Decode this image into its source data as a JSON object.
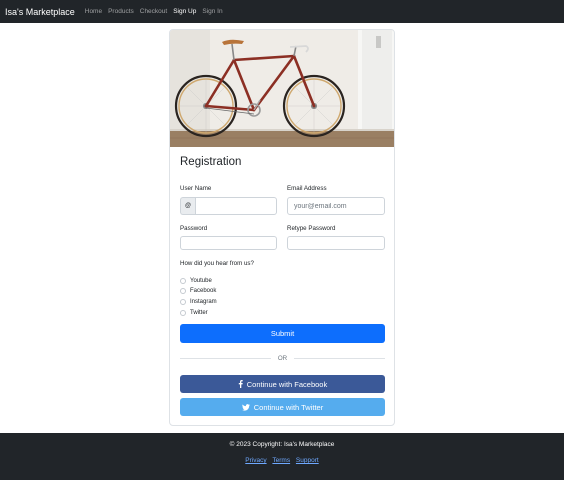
{
  "navbar": {
    "brand": "Isa's Marketplace",
    "links": [
      "Home",
      "Products",
      "Checkout",
      "Sign Up",
      "Sign In"
    ]
  },
  "form": {
    "title": "Registration",
    "username_label": "User Name",
    "username_prefix": "@",
    "username_value": "",
    "email_label": "Email Address",
    "email_placeholder": "your@email.com",
    "password_label": "Password",
    "retype_label": "Retype Password",
    "hear_label": "How did you hear from us?",
    "options": [
      "Youtube",
      "Facebook",
      "Instagram",
      "Twitter"
    ],
    "submit_label": "Submit",
    "or_text": "OR",
    "facebook_label": "Continue with Facebook",
    "twitter_label": "Continue with Twitter"
  },
  "footer": {
    "copyright": "© 2023 Copyright: Isa's Marketplace",
    "links": [
      "Privacy",
      "Terms",
      "Support"
    ]
  },
  "icons": {
    "facebook": "facebook-f-icon",
    "twitter": "twitter-bird-icon"
  },
  "colors": {
    "navbar_bg": "#212529",
    "primary": "#0d6efd",
    "facebook": "#3b5998",
    "twitter": "#55acee",
    "footer_link": "#6ea8fe"
  }
}
